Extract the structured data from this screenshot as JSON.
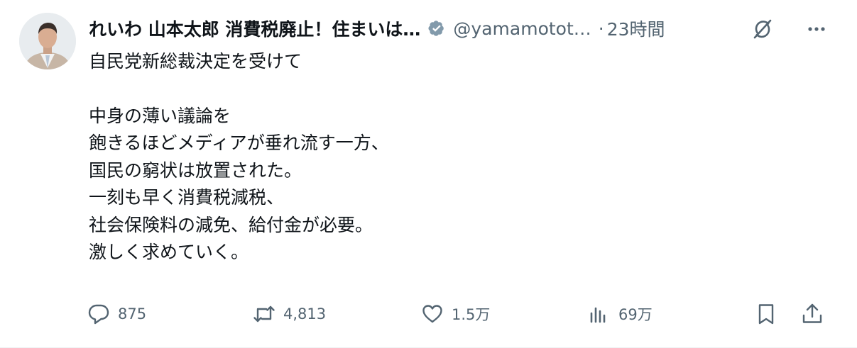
{
  "author": {
    "display_name": "れいわ 山本太郎 消費税廃止！住まいは…",
    "handle": "@yamamotot…",
    "separator": "·",
    "timestamp": "23時間",
    "verified": true,
    "verified_color": "#829aab"
  },
  "post": {
    "lines": [
      "自民党新総裁決定を受けて",
      "",
      "中身の薄い議論を",
      "飽きるほどメディアが垂れ流す一方、",
      "国民の窮状は放置された。",
      "一刻も早く消費税減税、",
      "社会保険料の減免、給付金が必要。",
      "激しく求めていく。"
    ]
  },
  "actions": {
    "reply": {
      "icon": "reply-icon",
      "count": "875"
    },
    "repost": {
      "icon": "repost-icon",
      "count": "4,813"
    },
    "like": {
      "icon": "like-icon",
      "count": "1.5万"
    },
    "views": {
      "icon": "views-icon",
      "count": "69万"
    },
    "bookmark": {
      "icon": "bookmark-icon"
    },
    "share": {
      "icon": "share-icon"
    }
  },
  "colors": {
    "text": "#0f1419",
    "secondary": "#536471"
  }
}
